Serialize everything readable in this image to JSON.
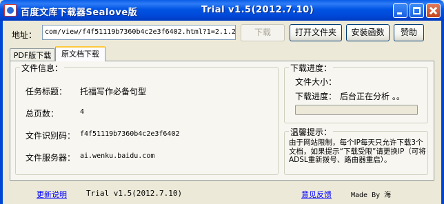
{
  "window": {
    "title": "百度文库下载器Sealove版",
    "title_center": "Trial v1.5(2012.7.10)"
  },
  "address": {
    "label": "地址：",
    "value": "com/view/f4f51119b7360b4c2e3f6402.html?1=2.1.2",
    "download_label": "下载",
    "open_folder_label": "打开文件夹",
    "install_label": "安装函数",
    "donate_label": "赞助"
  },
  "tabs": [
    {
      "label": "PDF版下载"
    },
    {
      "label": "原文档下载"
    }
  ],
  "file_info": {
    "legend": "文件信息：",
    "rows": [
      {
        "label": "任务标题：",
        "value": "托福写作必备句型"
      },
      {
        "label": "总页数：",
        "value": "4"
      },
      {
        "label": "文件识别码：",
        "value": "f4f51119b7360b4c2e3f6402"
      },
      {
        "label": "文件服务器：",
        "value": "ai.wenku.baidu.com"
      }
    ]
  },
  "progress": {
    "legend": "下载进度：",
    "size_label": "文件大小：",
    "size_value": "",
    "progress_label": "下载进度：",
    "progress_status": "后台正在分析  。。",
    "fraction": 0.0
  },
  "tips": {
    "legend": "温馨提示：",
    "text": "由于网站限制，每个IP每天只允许下载3个文档，如果提示“下载受限”请更换IP（可将ADSL重新拨号、路由器重启）。"
  },
  "status_bar": {
    "update_link": "更新说明",
    "version": "Trial v1.5(2012.7.10)",
    "feedback_link": "意见反馈",
    "made_by": "Made By 海"
  },
  "colors": {
    "titlebar": "#0054e3",
    "window_bg": "#ece9d8",
    "link": "#0000ff"
  }
}
